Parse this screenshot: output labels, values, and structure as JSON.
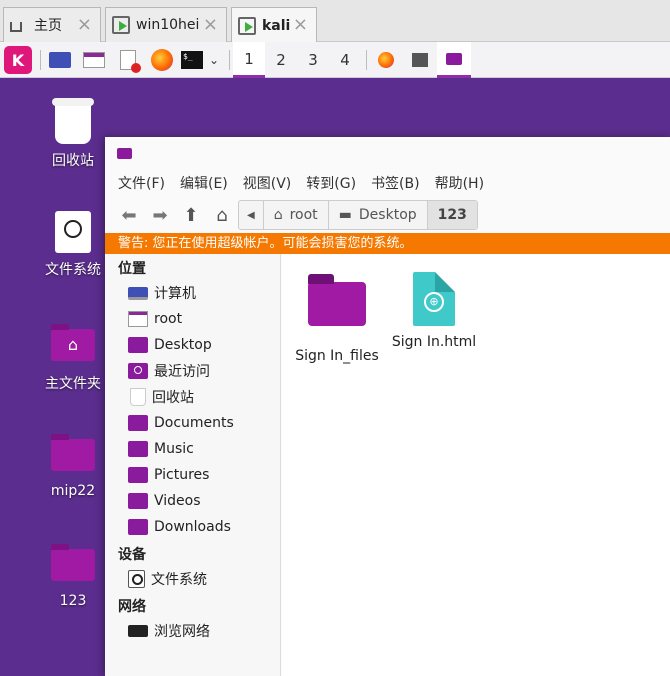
{
  "vm_tabs": [
    {
      "label": "主页",
      "icon": "home-icon"
    },
    {
      "label": "win10hei",
      "icon": "vm-icon"
    },
    {
      "label": "kali",
      "icon": "vm-icon"
    }
  ],
  "panel": {
    "logo_glyph": "K",
    "workspaces": [
      "1",
      "2",
      "3",
      "4"
    ],
    "terminal_glyph": "$_",
    "chevron": "⌄"
  },
  "desktop": {
    "icons": [
      {
        "label": "回收站"
      },
      {
        "label": "文件系统"
      },
      {
        "label": "主文件夹"
      },
      {
        "label": "mip22"
      },
      {
        "label": "123"
      }
    ]
  },
  "file_manager": {
    "menu": [
      "文件(F)",
      "编辑(E)",
      "视图(V)",
      "转到(G)",
      "书签(B)",
      "帮助(H)"
    ],
    "breadcrumbs": [
      "root",
      "Desktop",
      "123"
    ],
    "warning": "警告: 您正在使用超级帐户。可能会损害您的系统。",
    "sidebar": {
      "places_header": "位置",
      "places": [
        "计算机",
        "root",
        "Desktop",
        "最近访问",
        "回收站",
        "Documents",
        "Music",
        "Pictures",
        "Videos",
        "Downloads"
      ],
      "devices_header": "设备",
      "devices": [
        "文件系统"
      ],
      "network_header": "网络",
      "network": [
        "浏览网络"
      ]
    },
    "files": [
      {
        "name": "Sign In_files",
        "type": "folder"
      },
      {
        "name": "Sign In.html",
        "type": "html"
      }
    ]
  },
  "colors": {
    "accent_purple": "#a01aa4",
    "warning_orange": "#f57900",
    "kali_pink": "#e0177a",
    "html_teal": "#3fc9c9"
  }
}
